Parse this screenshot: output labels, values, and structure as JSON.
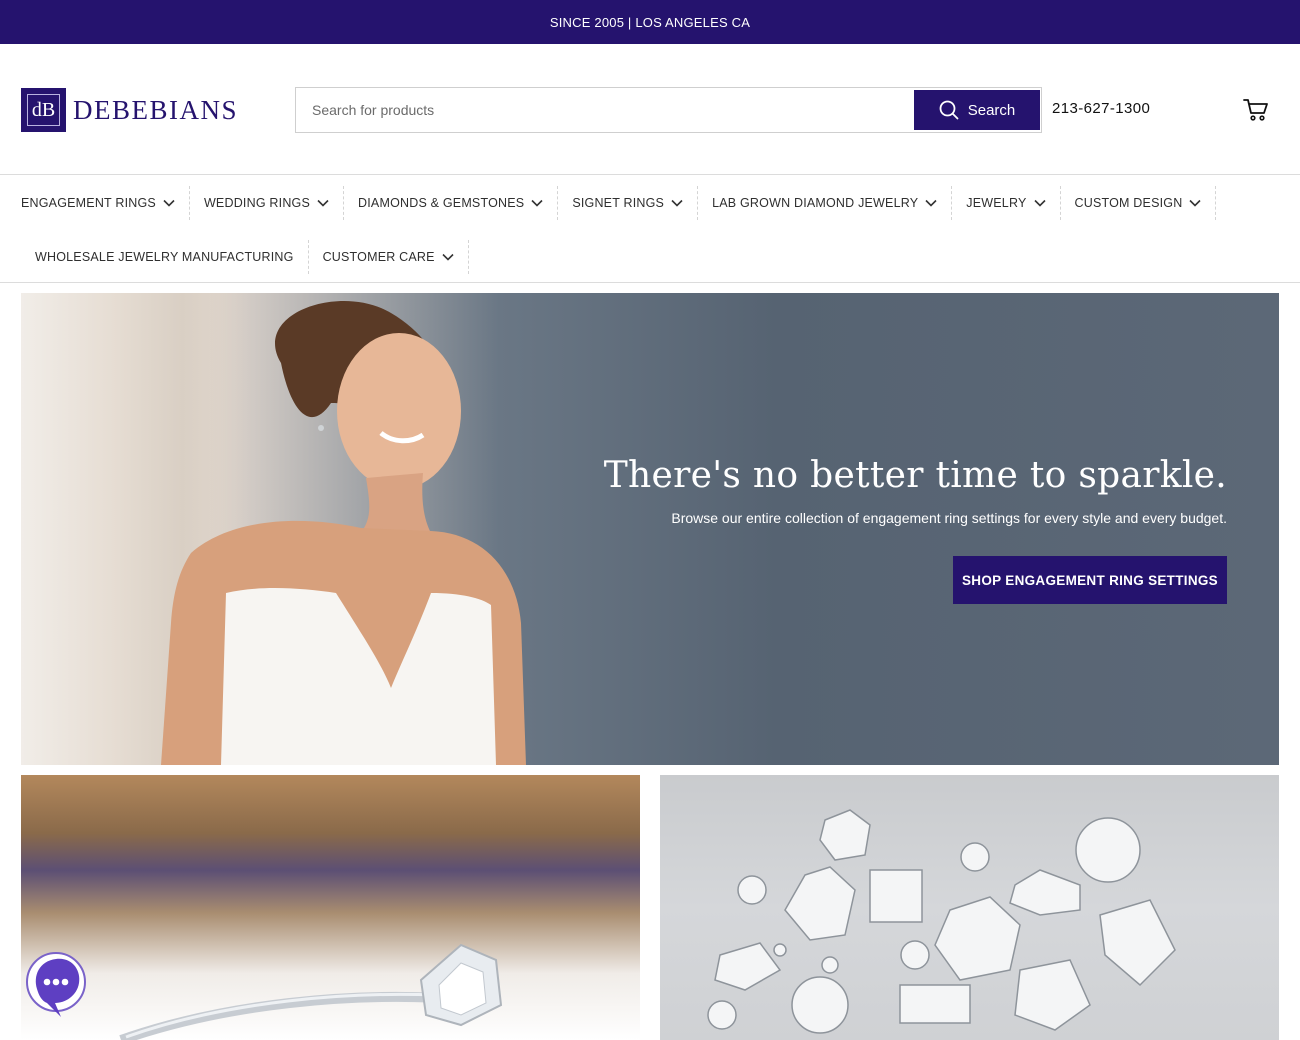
{
  "topbar": {
    "text": "SINCE 2005 | LOS ANGELES CA"
  },
  "brand": {
    "mark": "dB",
    "name": "DEBEBIANS",
    "color": "#25136e"
  },
  "search": {
    "placeholder": "Search for products",
    "value": "",
    "button_label": "Search",
    "icon": "search-icon"
  },
  "contact": {
    "phone": "213-627-1300"
  },
  "cart": {
    "icon": "cart-icon"
  },
  "nav": {
    "row1": [
      {
        "label": "ENGAGEMENT RINGS",
        "dropdown": true
      },
      {
        "label": "WEDDING RINGS",
        "dropdown": true
      },
      {
        "label": "DIAMONDS & GEMSTONES",
        "dropdown": true
      },
      {
        "label": "SIGNET RINGS",
        "dropdown": true
      },
      {
        "label": "LAB GROWN DIAMOND JEWELRY",
        "dropdown": true
      },
      {
        "label": "JEWELRY",
        "dropdown": true
      },
      {
        "label": "CUSTOM DESIGN",
        "dropdown": true
      }
    ],
    "row2": [
      {
        "label": "WHOLESALE JEWELRY MANUFACTURING",
        "dropdown": false
      },
      {
        "label": "CUSTOMER CARE",
        "dropdown": true
      }
    ]
  },
  "hero": {
    "title": "There's no better time to sparkle.",
    "subtitle": "Browse our entire collection of engagement ring settings for every style and every budget.",
    "cta": "SHOP ENGAGEMENT RING SETTINGS"
  },
  "chat": {
    "icon": "chat-bubble-icon"
  }
}
